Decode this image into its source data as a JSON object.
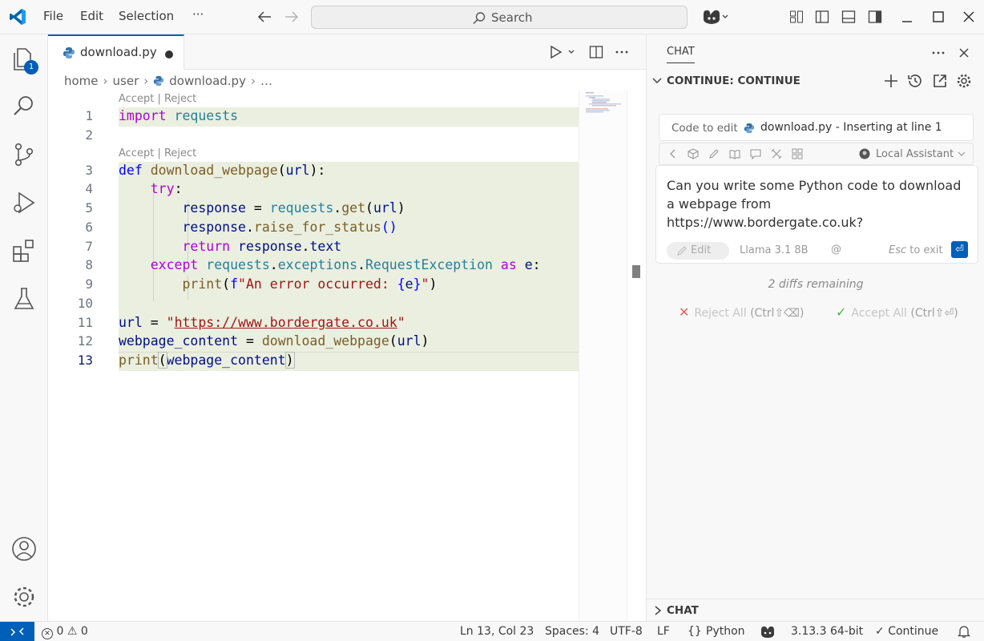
{
  "menu": {
    "file": "File",
    "edit": "Edit",
    "selection": "Selection",
    "more": "···"
  },
  "search": {
    "label": "Search"
  },
  "activity": {
    "explorer_badge": "1"
  },
  "tab": {
    "name": "download.py"
  },
  "breadcrumb": {
    "home": "home",
    "user": "user",
    "file": "download.py",
    "more": "…"
  },
  "codelens": {
    "label": "Accept | Reject"
  },
  "line_numbers": [
    "1",
    "2",
    "3",
    "4",
    "5",
    "6",
    "7",
    "8",
    "9",
    "10",
    "11",
    "12",
    "13"
  ],
  "code": {
    "l1_kw": "import",
    "l1_mod": "requests",
    "l3_kw": "def",
    "l3_fn": "download_webpage",
    "l3_open": "(",
    "l3_arg": "url",
    "l3_close": "):",
    "l4_kw": "try",
    "l4_colon": ":",
    "l5_var": "response",
    "l5_eq": " = ",
    "l5_mod": "requests",
    "l5_dot": ".",
    "l5_fn": "get",
    "l5_open": "(",
    "l5_arg": "url",
    "l5_close": ")",
    "l6_var": "response",
    "l6_dot": ".",
    "l6_fn": "raise_for_status",
    "l6_paren": "()",
    "l7_kw": "return",
    "l7_var": "response",
    "l7_dot": ".",
    "l7_attr": "text",
    "l8_kw": "except",
    "l8_mod": "requests",
    "l8_dot1": ".",
    "l8_mod2": "exceptions",
    "l8_dot2": ".",
    "l8_cls": "RequestException",
    "l8_as": "as",
    "l8_var": "e",
    "l8_colon": ":",
    "l9_fn": "print",
    "l9_open": "(",
    "l9_f": "f",
    "l9_str1": "\"An error occurred: ",
    "l9_brace1": "{",
    "l9_var": "e",
    "l9_brace2": "}",
    "l9_str2": "\"",
    "l9_close": ")",
    "l11_var": "url",
    "l11_eq": " = ",
    "l11_q1": "\"",
    "l11_url": "https://www.bordergate.co.uk",
    "l11_q2": "\"",
    "l12_var": "webpage_content",
    "l12_eq": " = ",
    "l12_fn": "download_webpage",
    "l12_open": "(",
    "l12_arg": "url",
    "l12_close": ")",
    "l13_fn": "print",
    "l13_open": "(",
    "l13_arg": "webpage_content",
    "l13_close": ")"
  },
  "chat": {
    "tab_label": "CHAT",
    "title": "CONTINUE: CONTINUE",
    "code_to_edit_label": "Code to edit",
    "code_to_edit_file": "download.py - Inserting at line 1",
    "assistant": "Local Assistant",
    "prompt": "Can you write some Python code to download a webpage from https://www.bordergate.co.uk?",
    "edit_label": "Edit",
    "model": "Llama 3.1 8B",
    "at": "@",
    "esc_key": "Esc",
    "esc_text": " to exit",
    "send_glyph": "⏎",
    "diffs_remaining": "2 diffs remaining",
    "reject_all": "Reject All",
    "reject_shortcut": "(Ctrl⇧⌫)",
    "accept_all": "Accept All",
    "accept_shortcut": "(Ctrl⇧⏎)",
    "bottom_label": "CHAT"
  },
  "status": {
    "errors": "0",
    "warnings": "0",
    "position": "Ln 13, Col 23",
    "spaces": "Spaces: 4",
    "encoding": "UTF-8",
    "eol": "LF",
    "language_braces": "{}",
    "language": "Python",
    "interpreter": "3.13.3 64-bit",
    "continue": "Continue"
  },
  "colors": {
    "accent": "#005fb8",
    "highlight": "#eaefe0"
  }
}
